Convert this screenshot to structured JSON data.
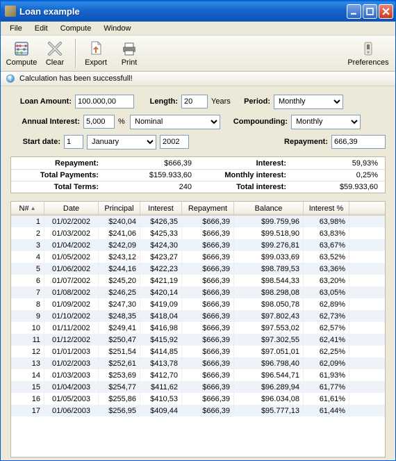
{
  "window": {
    "title": "Loan example"
  },
  "menu": [
    "File",
    "Edit",
    "Compute",
    "Window"
  ],
  "toolbar": {
    "compute": "Compute",
    "clear": "Clear",
    "export": "Export",
    "print": "Print",
    "preferences": "Preferences"
  },
  "status": {
    "msg": "Calculation has been successfull!"
  },
  "form": {
    "loan_amount_label": "Loan Amount:",
    "loan_amount": "100.000,00",
    "length_label": "Length:",
    "length": "20",
    "length_unit": "Years",
    "period_label": "Period:",
    "period": "Monthly",
    "annual_interest_label": "Annual Interest:",
    "annual_interest": "5,000",
    "pct": "%",
    "interest_type": "Nominal",
    "compounding_label": "Compounding:",
    "compounding": "Monthly",
    "start_date_label": "Start date:",
    "start_day": "1",
    "start_month": "January",
    "start_year": "2002",
    "repayment_label": "Repayment:",
    "repayment": "666,39"
  },
  "summary": {
    "rows": [
      {
        "l1": "Repayment:",
        "v1": "$666,39",
        "l2": "Interest:",
        "v2": "59,93%"
      },
      {
        "l1": "Total Payments:",
        "v1": "$159.933,60",
        "l2": "Monthly interest:",
        "v2": "0,25%"
      },
      {
        "l1": "Total Terms:",
        "v1": "240",
        "l2": "Total interest:",
        "v2": "$59.933,60"
      }
    ]
  },
  "grid": {
    "cols": [
      "N#",
      "Date",
      "Principal",
      "Interest",
      "Repayment",
      "Balance",
      "Interest %"
    ],
    "rows": [
      {
        "n": "1",
        "date": "01/02/2002",
        "principal": "$240,04",
        "interest": "$426,35",
        "repayment": "$666,39",
        "balance": "$99.759,96",
        "ipct": "63,98%"
      },
      {
        "n": "2",
        "date": "01/03/2002",
        "principal": "$241,06",
        "interest": "$425,33",
        "repayment": "$666,39",
        "balance": "$99.518,90",
        "ipct": "63,83%"
      },
      {
        "n": "3",
        "date": "01/04/2002",
        "principal": "$242,09",
        "interest": "$424,30",
        "repayment": "$666,39",
        "balance": "$99.276,81",
        "ipct": "63,67%"
      },
      {
        "n": "4",
        "date": "01/05/2002",
        "principal": "$243,12",
        "interest": "$423,27",
        "repayment": "$666,39",
        "balance": "$99.033,69",
        "ipct": "63,52%"
      },
      {
        "n": "5",
        "date": "01/06/2002",
        "principal": "$244,16",
        "interest": "$422,23",
        "repayment": "$666,39",
        "balance": "$98.789,53",
        "ipct": "63,36%"
      },
      {
        "n": "6",
        "date": "01/07/2002",
        "principal": "$245,20",
        "interest": "$421,19",
        "repayment": "$666,39",
        "balance": "$98.544,33",
        "ipct": "63,20%"
      },
      {
        "n": "7",
        "date": "01/08/2002",
        "principal": "$246,25",
        "interest": "$420,14",
        "repayment": "$666,39",
        "balance": "$98.298,08",
        "ipct": "63,05%"
      },
      {
        "n": "8",
        "date": "01/09/2002",
        "principal": "$247,30",
        "interest": "$419,09",
        "repayment": "$666,39",
        "balance": "$98.050,78",
        "ipct": "62,89%"
      },
      {
        "n": "9",
        "date": "01/10/2002",
        "principal": "$248,35",
        "interest": "$418,04",
        "repayment": "$666,39",
        "balance": "$97.802,43",
        "ipct": "62,73%"
      },
      {
        "n": "10",
        "date": "01/11/2002",
        "principal": "$249,41",
        "interest": "$416,98",
        "repayment": "$666,39",
        "balance": "$97.553,02",
        "ipct": "62,57%"
      },
      {
        "n": "11",
        "date": "01/12/2002",
        "principal": "$250,47",
        "interest": "$415,92",
        "repayment": "$666,39",
        "balance": "$97.302,55",
        "ipct": "62,41%"
      },
      {
        "n": "12",
        "date": "01/01/2003",
        "principal": "$251,54",
        "interest": "$414,85",
        "repayment": "$666,39",
        "balance": "$97.051,01",
        "ipct": "62,25%"
      },
      {
        "n": "13",
        "date": "01/02/2003",
        "principal": "$252,61",
        "interest": "$413,78",
        "repayment": "$666,39",
        "balance": "$96.798,40",
        "ipct": "62,09%"
      },
      {
        "n": "14",
        "date": "01/03/2003",
        "principal": "$253,69",
        "interest": "$412,70",
        "repayment": "$666,39",
        "balance": "$96.544,71",
        "ipct": "61,93%"
      },
      {
        "n": "15",
        "date": "01/04/2003",
        "principal": "$254,77",
        "interest": "$411,62",
        "repayment": "$666,39",
        "balance": "$96.289,94",
        "ipct": "61,77%"
      },
      {
        "n": "16",
        "date": "01/05/2003",
        "principal": "$255,86",
        "interest": "$410,53",
        "repayment": "$666,39",
        "balance": "$96.034,08",
        "ipct": "61,61%"
      },
      {
        "n": "17",
        "date": "01/06/2003",
        "principal": "$256,95",
        "interest": "$409,44",
        "repayment": "$666,39",
        "balance": "$95.777,13",
        "ipct": "61,44%"
      }
    ]
  }
}
